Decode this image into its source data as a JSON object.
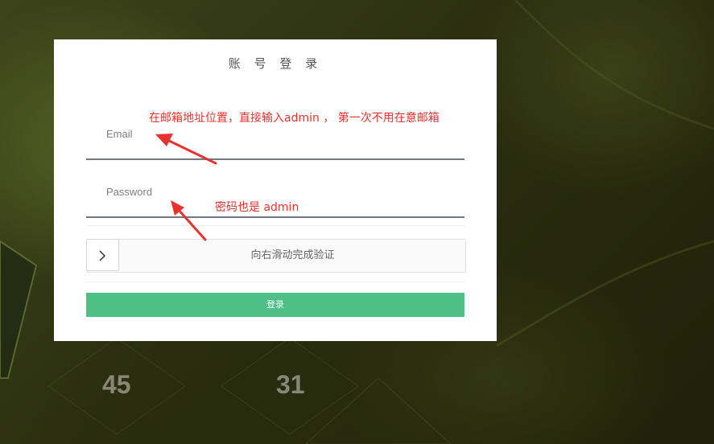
{
  "background": {
    "numbers": [
      "45",
      "31"
    ]
  },
  "login": {
    "title": "账 号 登 录",
    "email_label": "Email",
    "password_label": "Password",
    "slider_text": "向右滑动完成验证",
    "button_label": "登录"
  },
  "annotations": {
    "email_note": "在邮箱地址位置，直接输入admin ， 第一次不用在意邮箱",
    "password_note": "密码也是 admin"
  },
  "colors": {
    "accent_green": "#4dbf87",
    "annotation_red": "#e8322e",
    "field_underline": "#707888"
  }
}
